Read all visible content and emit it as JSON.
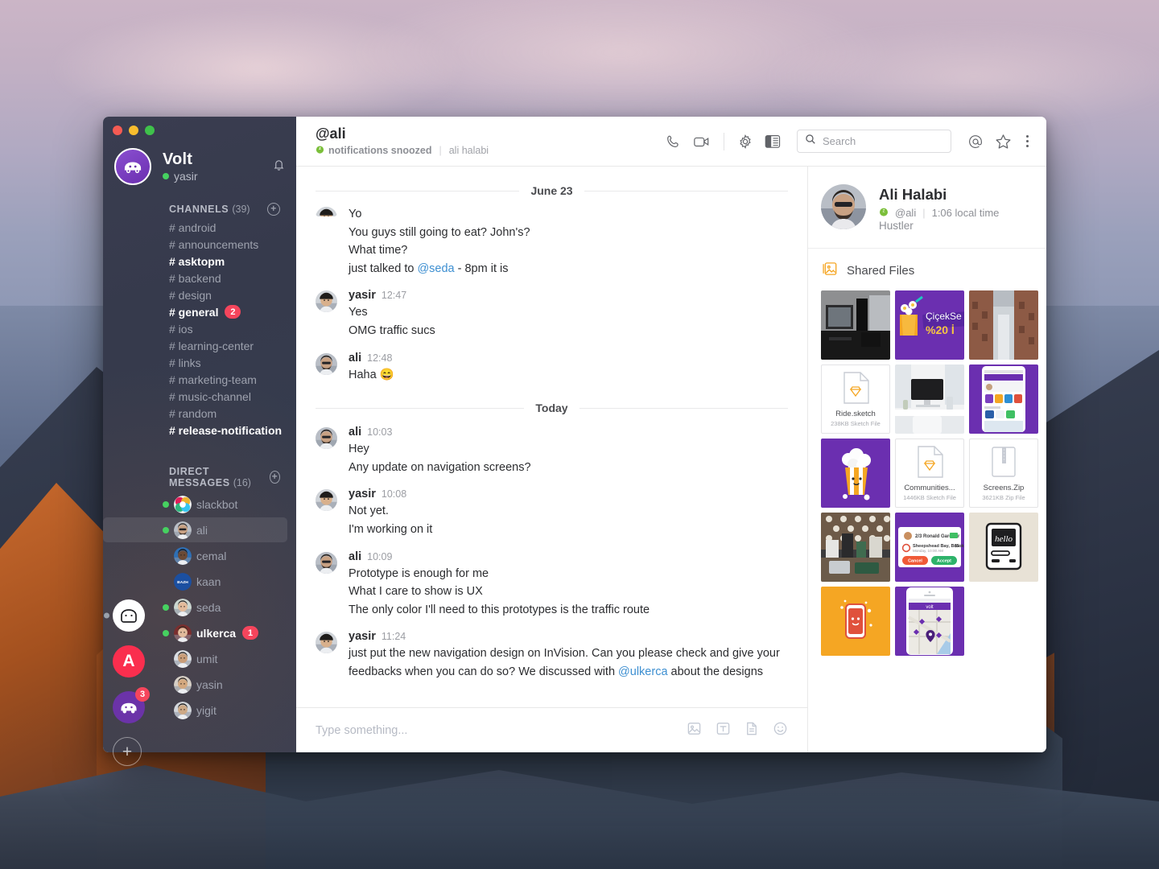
{
  "workspace_rail": {
    "items": [
      {
        "name": "reddit-workspace",
        "kind": "white",
        "glyph": "",
        "active": true,
        "badge": ""
      },
      {
        "name": "a-workspace",
        "kind": "red",
        "glyph": "A",
        "active": false,
        "badge": ""
      },
      {
        "name": "volt-workspace",
        "kind": "purple",
        "glyph": "",
        "active": false,
        "badge": "3"
      }
    ],
    "add_label": "+"
  },
  "sidebar": {
    "team_name": "Volt",
    "user_name": "yasir",
    "presence": "active",
    "bell_icon": "bell-icon",
    "channels_header": "CHANNELS",
    "channels_count": "(39)",
    "channels": [
      {
        "label": "# android",
        "unread": false,
        "badge": ""
      },
      {
        "label": "# announcements",
        "unread": false,
        "badge": ""
      },
      {
        "label": "# asktopm",
        "unread": true,
        "badge": ""
      },
      {
        "label": "# backend",
        "unread": false,
        "badge": ""
      },
      {
        "label": "# design",
        "unread": false,
        "badge": ""
      },
      {
        "label": "# general",
        "unread": true,
        "badge": "2"
      },
      {
        "label": "# ios",
        "unread": false,
        "badge": ""
      },
      {
        "label": "# learning-center",
        "unread": false,
        "badge": ""
      },
      {
        "label": "# links",
        "unread": false,
        "badge": ""
      },
      {
        "label": "# marketing-team",
        "unread": false,
        "badge": ""
      },
      {
        "label": "# music-channel",
        "unread": false,
        "badge": ""
      },
      {
        "label": "# random",
        "unread": false,
        "badge": ""
      },
      {
        "label": "# release-notification",
        "unread": true,
        "badge": ""
      }
    ],
    "dm_header": "DIRECT MESSAGES",
    "dm_count": "(16)",
    "dms": [
      {
        "label": "slackbot",
        "online": true,
        "active": false,
        "unread": false,
        "badge": "",
        "av": "slackbot"
      },
      {
        "label": "ali",
        "online": true,
        "active": true,
        "unread": false,
        "badge": "",
        "av": "ali"
      },
      {
        "label": "cemal",
        "online": false,
        "active": false,
        "unread": false,
        "badge": "",
        "av": "cemal"
      },
      {
        "label": "kaan",
        "online": false,
        "active": false,
        "unread": false,
        "badge": "",
        "av": "kaan"
      },
      {
        "label": "seda",
        "online": true,
        "active": false,
        "unread": false,
        "badge": "",
        "av": "seda"
      },
      {
        "label": "ulkerca",
        "online": true,
        "active": false,
        "unread": true,
        "badge": "1",
        "av": "ulkerca"
      },
      {
        "label": "umit",
        "online": false,
        "active": false,
        "unread": false,
        "badge": "",
        "av": "umit"
      },
      {
        "label": "yasin",
        "online": false,
        "active": false,
        "unread": false,
        "badge": "",
        "av": "yasin"
      },
      {
        "label": "yigit",
        "online": false,
        "active": false,
        "unread": false,
        "badge": "",
        "av": "yigit"
      }
    ]
  },
  "topbar": {
    "title": "@ali",
    "snoozed_label": "notifications snoozed",
    "divider": "|",
    "member_name": "ali halabi",
    "icons": [
      "phone-icon",
      "video-icon",
      "gear-icon",
      "sidebar-toggle-icon",
      "mentions-icon",
      "star-icon",
      "kebab-menu-icon"
    ],
    "search_placeholder": "Search",
    "search_value": ""
  },
  "messages": {
    "groups": [
      {
        "divider": "June 23",
        "items": [
          {
            "user": "",
            "time": "",
            "av": "yasir",
            "clipped": true,
            "lines": [
              {
                "parts": [
                  {
                    "t": "Yo",
                    "m": false
                  }
                ]
              },
              {
                "parts": [
                  {
                    "t": "You guys still going to eat? John's?",
                    "m": false
                  }
                ]
              },
              {
                "parts": [
                  {
                    "t": "What time?",
                    "m": false
                  }
                ]
              },
              {
                "parts": [
                  {
                    "t": "just talked to ",
                    "m": false
                  },
                  {
                    "t": "@seda",
                    "m": true
                  },
                  {
                    "t": " - 8pm it is",
                    "m": false
                  }
                ]
              }
            ]
          },
          {
            "user": "yasir",
            "time": "12:47",
            "av": "yasir",
            "clipped": false,
            "lines": [
              {
                "parts": [
                  {
                    "t": "Yes",
                    "m": false
                  }
                ]
              },
              {
                "parts": [
                  {
                    "t": "OMG traffic sucs",
                    "m": false
                  }
                ]
              }
            ]
          },
          {
            "user": "ali",
            "time": "12:48",
            "av": "ali",
            "clipped": false,
            "lines": [
              {
                "parts": [
                  {
                    "t": "Haha 😄",
                    "m": false
                  }
                ]
              }
            ]
          }
        ]
      },
      {
        "divider": "Today",
        "items": [
          {
            "user": "ali",
            "time": "10:03",
            "av": "ali",
            "clipped": false,
            "lines": [
              {
                "parts": [
                  {
                    "t": "Hey",
                    "m": false
                  }
                ]
              },
              {
                "parts": [
                  {
                    "t": "Any update on navigation screens?",
                    "m": false
                  }
                ]
              }
            ]
          },
          {
            "user": "yasir",
            "time": "10:08",
            "av": "yasir",
            "clipped": false,
            "lines": [
              {
                "parts": [
                  {
                    "t": "Not yet.",
                    "m": false
                  }
                ]
              },
              {
                "parts": [
                  {
                    "t": "I'm working on it",
                    "m": false
                  }
                ]
              }
            ]
          },
          {
            "user": "ali",
            "time": "10:09",
            "av": "ali",
            "clipped": false,
            "lines": [
              {
                "parts": [
                  {
                    "t": "Prototype is enough for me",
                    "m": false
                  }
                ]
              },
              {
                "parts": [
                  {
                    "t": "What I care to show is UX",
                    "m": false
                  }
                ]
              },
              {
                "parts": [
                  {
                    "t": "The only color I'll need to this prototypes is the traffic route",
                    "m": false
                  }
                ]
              }
            ]
          },
          {
            "user": "yasir",
            "time": "11:24",
            "av": "yasir",
            "clipped": false,
            "lines": [
              {
                "parts": [
                  {
                    "t": "just put the new navigation design on InVision. Can you please check and give your feedbacks when you can do so? We discussed with ",
                    "m": false
                  },
                  {
                    "t": "@ulkerca",
                    "m": true
                  },
                  {
                    "t": " about the designs",
                    "m": false
                  }
                ]
              }
            ]
          }
        ]
      }
    ]
  },
  "composer": {
    "placeholder": "Type something...",
    "value": "",
    "icons": [
      "image-icon",
      "text-format-icon",
      "document-icon",
      "emoji-icon"
    ]
  },
  "right_panel": {
    "profile": {
      "name": "Ali Halabi",
      "handle": "@ali",
      "divider": "|",
      "local_time": "1:06 local time",
      "title": "Hustler",
      "status_icon": "snooze-icon"
    },
    "shared_files": {
      "icon": "files-icon",
      "title": "Shared Files",
      "tiles": [
        {
          "kind": "photo-desk-dark",
          "name": "",
          "meta": ""
        },
        {
          "kind": "banner-cicek",
          "name": "ÇiçekSe",
          "meta": "%20 İ"
        },
        {
          "kind": "photo-bricks",
          "name": "",
          "meta": ""
        },
        {
          "kind": "sketch-file",
          "name": "Ride.sketch",
          "meta": "238KB Sketch File"
        },
        {
          "kind": "photo-desk-white",
          "name": "",
          "meta": ""
        },
        {
          "kind": "app-purple-grid",
          "name": "",
          "meta": ""
        },
        {
          "kind": "illus-popcorn",
          "name": "",
          "meta": ""
        },
        {
          "kind": "sketch-file",
          "name": "Communities...",
          "meta": "1446KB Sketch File"
        },
        {
          "kind": "zip-file",
          "name": "Screens.Zip",
          "meta": "3621KB Zip File"
        },
        {
          "kind": "photo-cafe",
          "name": "",
          "meta": ""
        },
        {
          "kind": "app-accept-card",
          "name": "Ronald Gardner",
          "meta": "Sheepshead Bay, Brooklyn"
        },
        {
          "kind": "illus-mac",
          "name": "hello",
          "meta": ""
        },
        {
          "kind": "illus-phone",
          "name": "",
          "meta": ""
        },
        {
          "kind": "app-map",
          "name": "volt",
          "meta": ""
        }
      ]
    }
  },
  "colors": {
    "sidebar_bg": "#363a4c",
    "badge_red": "#f5455c",
    "presence_green": "#46d160",
    "mention_blue": "#3d8fd1",
    "brand_purple": "#6b33a8",
    "accent_orange": "#f5a623"
  }
}
